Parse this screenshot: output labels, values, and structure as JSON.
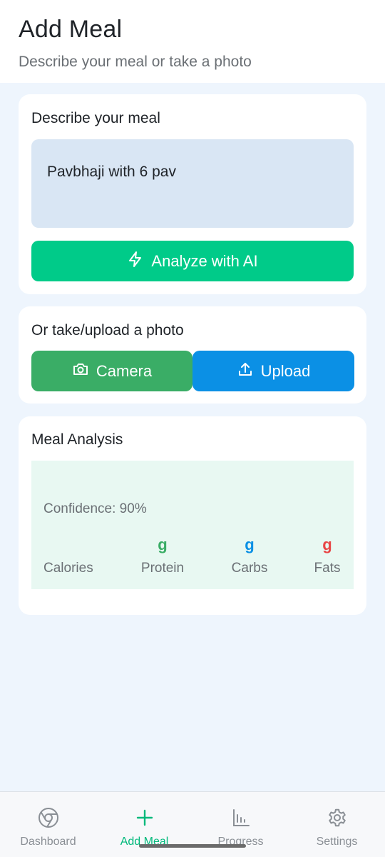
{
  "header": {
    "title": "Add Meal",
    "subtitle": "Describe your meal or take a photo"
  },
  "describe": {
    "title": "Describe your meal",
    "input_value": "Pavbhaji with 6 pav",
    "analyze_label": "Analyze with AI",
    "analyze_icon": "lightning-icon"
  },
  "photo": {
    "title": "Or take/upload a photo",
    "camera_label": "Camera",
    "camera_icon": "camera-icon",
    "upload_label": "Upload",
    "upload_icon": "upload-icon"
  },
  "analysis": {
    "title": "Meal Analysis",
    "confidence": "Confidence: 90%",
    "macros": [
      {
        "label": "Calories",
        "unit": ""
      },
      {
        "label": "Protein",
        "unit": "g"
      },
      {
        "label": "Carbs",
        "unit": "g"
      },
      {
        "label": "Fats",
        "unit": "g"
      }
    ]
  },
  "nav": {
    "items": [
      {
        "label": "Dashboard",
        "icon": "dashboard-icon",
        "active": false
      },
      {
        "label": "Add Meal",
        "icon": "plus-icon",
        "active": true
      },
      {
        "label": "Progress",
        "icon": "chart-icon",
        "active": false
      },
      {
        "label": "Settings",
        "icon": "gear-icon",
        "active": false
      }
    ]
  },
  "colors": {
    "accent": "#00cb89",
    "camera": "#3aad66",
    "upload": "#0b90e5",
    "fats": "#e84545",
    "background": "#eef5fd"
  }
}
